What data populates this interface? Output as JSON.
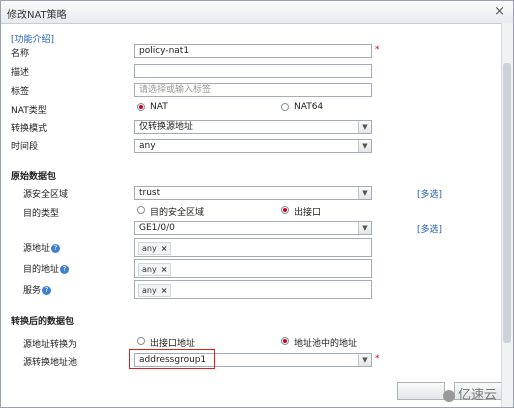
{
  "dialog": {
    "title": "修改NAT策略",
    "help_link": "[功能介绍]"
  },
  "fields": {
    "name_label": "名称",
    "name_value": "policy-nat1",
    "desc_label": "描述",
    "tag_label": "标签",
    "tag_placeholder": "请选择或输入标签",
    "nat_type_label": "NAT类型",
    "nat_type_opt1": "NAT",
    "nat_type_opt2": "NAT64",
    "mode_label": "转换模式",
    "mode_value": "仅转换源地址",
    "time_label": "时间段",
    "time_value": "any"
  },
  "original": {
    "section": "原始数据包",
    "src_zone_label": "源安全区域",
    "src_zone_value": "trust",
    "multi1": "[多选]",
    "dst_type_label": "目的类型",
    "dst_type_opt1": "目的安全区域",
    "dst_type_opt2": "出接口",
    "iface_value": "GE1/0/0",
    "multi2": "[多选]",
    "src_addr_label": "源地址",
    "dst_addr_label": "目的地址",
    "service_label": "服务",
    "help_icon": "?",
    "tag_any": "any",
    "tag_remove": "×"
  },
  "translated": {
    "section": "转换后的数据包",
    "convert_label": "源地址转换为",
    "convert_opt1": "出接口地址",
    "convert_opt2": "地址池中的地址",
    "pool_label": "源转换地址池",
    "pool_value": "addressgroup1"
  },
  "watermark": "亿速云",
  "icons": {
    "close": "close-icon",
    "dropdown": "chevron-down-icon",
    "help": "question-icon"
  }
}
